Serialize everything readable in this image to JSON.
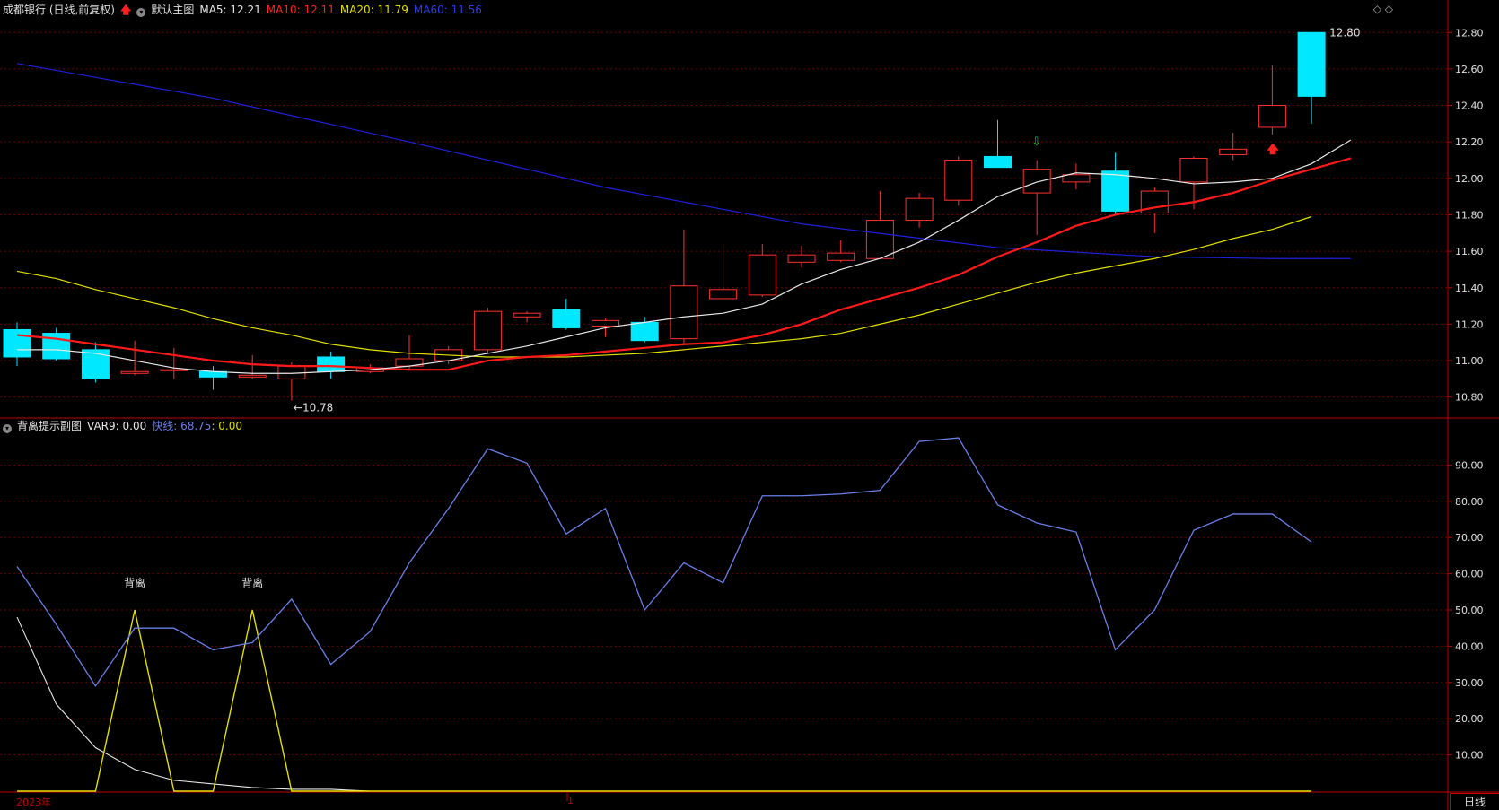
{
  "main_header": {
    "stock": "成都银行 (日线,前复权)",
    "indicator_name": "默认主图",
    "ma5": "MA5: 12.21",
    "ma10": "MA10: 12.11",
    "ma20": "MA20: 11.79",
    "ma60": "MA60: 11.56"
  },
  "sub_header": {
    "name": "背离提示副图",
    "var9": "VAR9: 0.00",
    "fast": "快线: 68.75",
    "slow": ": 0.00"
  },
  "colors": {
    "up": "#ff3030",
    "down": "#00e8ff",
    "ma5": "#e8e8e8",
    "ma10": "#ff1a1a",
    "ma20": "#e0e000",
    "ma60": "#2020e0",
    "fast": "#6a7fe8",
    "slow": "#e8e8e8",
    "var": "#e0e000",
    "grid": "#6a0000",
    "axis": "#c00000"
  },
  "bottom_axis": {
    "year": "2023年",
    "month": "1",
    "period_tab": "日线"
  },
  "icons": {
    "period_arrow": "red-up-arrow",
    "window_controls": "◇ ◇"
  },
  "chart_data": [
    {
      "type": "candlestick",
      "title": "成都银行 (日线,前复权)",
      "ylim": [
        10.7,
        12.88
      ],
      "yticks": [
        10.8,
        11.0,
        11.2,
        11.4,
        11.6,
        11.8,
        12.0,
        12.2,
        12.4,
        12.6,
        12.8
      ],
      "candles": [
        {
          "o": 11.17,
          "h": 11.21,
          "l": 10.97,
          "c": 11.02
        },
        {
          "o": 11.15,
          "h": 11.18,
          "l": 11.0,
          "c": 11.01
        },
        {
          "o": 11.06,
          "h": 11.1,
          "l": 10.88,
          "c": 10.9
        },
        {
          "o": 10.93,
          "h": 11.11,
          "l": 10.92,
          "c": 10.94
        },
        {
          "o": 10.95,
          "h": 11.07,
          "l": 10.9,
          "c": 10.95
        },
        {
          "o": 10.94,
          "h": 10.97,
          "l": 10.84,
          "c": 10.91
        },
        {
          "o": 10.91,
          "h": 11.03,
          "l": 10.9,
          "c": 10.92
        },
        {
          "o": 10.9,
          "h": 10.99,
          "l": 10.78,
          "c": 10.97
        },
        {
          "o": 11.02,
          "h": 11.05,
          "l": 10.9,
          "c": 10.94
        },
        {
          "o": 10.94,
          "h": 10.98,
          "l": 10.93,
          "c": 10.96
        },
        {
          "o": 10.97,
          "h": 11.14,
          "l": 10.95,
          "c": 11.01
        },
        {
          "o": 11.0,
          "h": 11.08,
          "l": 10.98,
          "c": 11.06
        },
        {
          "o": 11.06,
          "h": 11.29,
          "l": 11.04,
          "c": 11.27
        },
        {
          "o": 11.24,
          "h": 11.27,
          "l": 11.21,
          "c": 11.26
        },
        {
          "o": 11.28,
          "h": 11.34,
          "l": 11.17,
          "c": 11.18
        },
        {
          "o": 11.19,
          "h": 11.23,
          "l": 11.13,
          "c": 11.22
        },
        {
          "o": 11.21,
          "h": 11.24,
          "l": 11.1,
          "c": 11.11
        },
        {
          "o": 11.12,
          "h": 11.72,
          "l": 11.09,
          "c": 11.41
        },
        {
          "o": 11.34,
          "h": 11.64,
          "l": 11.34,
          "c": 11.39
        },
        {
          "o": 11.36,
          "h": 11.64,
          "l": 11.35,
          "c": 11.58
        },
        {
          "o": 11.54,
          "h": 11.63,
          "l": 11.51,
          "c": 11.58
        },
        {
          "o": 11.55,
          "h": 11.66,
          "l": 11.54,
          "c": 11.59
        },
        {
          "o": 11.56,
          "h": 11.93,
          "l": 11.56,
          "c": 11.77
        },
        {
          "o": 11.77,
          "h": 11.92,
          "l": 11.73,
          "c": 11.89
        },
        {
          "o": 11.88,
          "h": 12.12,
          "l": 11.85,
          "c": 12.1
        },
        {
          "o": 12.12,
          "h": 12.32,
          "l": 12.06,
          "c": 12.06
        },
        {
          "o": 11.92,
          "h": 12.1,
          "l": 11.69,
          "c": 12.05
        },
        {
          "o": 11.98,
          "h": 12.08,
          "l": 11.94,
          "c": 12.02
        },
        {
          "o": 12.04,
          "h": 12.14,
          "l": 11.8,
          "c": 11.82
        },
        {
          "o": 11.81,
          "h": 11.95,
          "l": 11.7,
          "c": 11.93
        },
        {
          "o": 11.98,
          "h": 12.12,
          "l": 11.83,
          "c": 12.11
        },
        {
          "o": 12.13,
          "h": 12.25,
          "l": 12.1,
          "c": 12.16
        },
        {
          "o": 12.28,
          "h": 12.62,
          "l": 12.24,
          "c": 12.4
        },
        {
          "o": 12.8,
          "h": 12.8,
          "l": 12.3,
          "c": 12.45
        }
      ],
      "ma5": [
        11.06,
        11.06,
        11.04,
        11.0,
        10.96,
        10.94,
        10.93,
        10.93,
        10.94,
        10.95,
        10.97,
        11.0,
        11.04,
        11.08,
        11.13,
        11.18,
        11.21,
        11.24,
        11.26,
        11.31,
        11.42,
        11.5,
        11.56,
        11.65,
        11.77,
        11.9,
        11.98,
        12.03,
        12.02,
        12.0,
        11.97,
        11.98,
        12.0,
        12.08,
        12.21
      ],
      "ma10": [
        11.14,
        11.12,
        11.09,
        11.06,
        11.03,
        11.0,
        10.98,
        10.97,
        10.97,
        10.96,
        10.95,
        10.95,
        11.0,
        11.02,
        11.03,
        11.05,
        11.07,
        11.09,
        11.1,
        11.14,
        11.2,
        11.28,
        11.34,
        11.4,
        11.47,
        11.57,
        11.65,
        11.74,
        11.8,
        11.84,
        11.87,
        11.92,
        11.99,
        12.05,
        12.11
      ],
      "ma20": [
        11.49,
        11.45,
        11.39,
        11.34,
        11.29,
        11.23,
        11.18,
        11.14,
        11.09,
        11.06,
        11.04,
        11.03,
        11.02,
        11.02,
        11.02,
        11.03,
        11.04,
        11.06,
        11.08,
        11.1,
        11.12,
        11.15,
        11.2,
        11.25,
        11.31,
        11.37,
        11.43,
        11.48,
        11.52,
        11.56,
        11.61,
        11.67,
        11.72,
        11.79
      ],
      "ma60": [
        12.63,
        12.44,
        12.2,
        11.95,
        11.75,
        11.62,
        11.57,
        11.56,
        11.56
      ],
      "ma60_index": [
        0,
        5,
        10,
        15,
        20,
        25,
        29,
        32,
        34
      ],
      "annotations": [
        {
          "text": "←10.78",
          "index": 7,
          "value": 10.78
        },
        {
          "text": "12.80",
          "index": 33,
          "value": 12.8
        }
      ]
    },
    {
      "type": "line",
      "title": "背离提示副图",
      "ylim": [
        0,
        100
      ],
      "yticks": [
        10,
        20,
        30,
        40,
        50,
        60,
        70,
        80,
        90
      ],
      "series": [
        {
          "name": "快线",
          "values": [
            62,
            46,
            29,
            45,
            45,
            39,
            41,
            53,
            35,
            44,
            63,
            78,
            94.5,
            90.5,
            71,
            78,
            50,
            63,
            57.5,
            81.5,
            81.5,
            82,
            83,
            96.5,
            97.5,
            79,
            74,
            71.5,
            39,
            50,
            72,
            76.5,
            76.5,
            68.75
          ]
        },
        {
          "name": "VAR9",
          "values": [
            0,
            0,
            0,
            50,
            0,
            0,
            50,
            0,
            0,
            0,
            0,
            0,
            0,
            0,
            0,
            0,
            0,
            0,
            0,
            0,
            0,
            0,
            0,
            0,
            0,
            0,
            0,
            0,
            0,
            0,
            0,
            0,
            0,
            0
          ]
        },
        {
          "name": "",
          "values": [
            48,
            24,
            12,
            6,
            3,
            2,
            1,
            0.5,
            0.5,
            0,
            0,
            0,
            0,
            0,
            0,
            0,
            0,
            0,
            0,
            0,
            0,
            0,
            0,
            0,
            0,
            0,
            0,
            0,
            0,
            0,
            0,
            0,
            0,
            0
          ]
        }
      ],
      "annotations": [
        {
          "text": "背离",
          "index": 3
        },
        {
          "text": "背离",
          "index": 6
        }
      ]
    }
  ]
}
